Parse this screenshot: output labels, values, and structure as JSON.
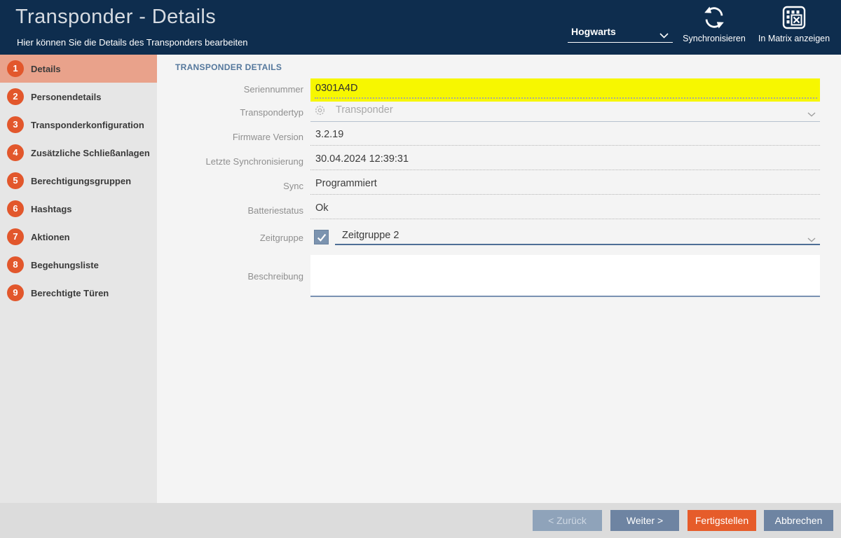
{
  "header": {
    "title": "Transponder - Details",
    "subtitle": "Hier können Sie die Details des Transponders bearbeiten",
    "project_selector": {
      "value": "Hogwarts"
    },
    "actions": [
      {
        "label": "Synchronisieren",
        "icon": "sync-icon"
      },
      {
        "label": "In Matrix anzeigen",
        "icon": "matrix-icon"
      }
    ]
  },
  "sidebar": {
    "items": [
      {
        "number": "1",
        "label": "Details",
        "active": true
      },
      {
        "number": "2",
        "label": "Personendetails",
        "active": false
      },
      {
        "number": "3",
        "label": "Transponderkonfiguration",
        "active": false
      },
      {
        "number": "4",
        "label": "Zusätzliche Schließanlagen",
        "active": false
      },
      {
        "number": "5",
        "label": "Berechtigungsgruppen",
        "active": false
      },
      {
        "number": "6",
        "label": "Hashtags",
        "active": false
      },
      {
        "number": "7",
        "label": "Aktionen",
        "active": false
      },
      {
        "number": "8",
        "label": "Begehungsliste",
        "active": false
      },
      {
        "number": "9",
        "label": "Berechtigte Türen",
        "active": false
      }
    ]
  },
  "main": {
    "section_title": "TRANSPONDER DETAILS",
    "fields": {
      "seriennummer": {
        "label": "Seriennummer",
        "value": "0301A4D",
        "highlight": "#f7f700"
      },
      "transpondertyp": {
        "label": "Transpondertyp",
        "value": "Transponder",
        "disabled": true
      },
      "firmware": {
        "label": "Firmware Version",
        "value": "3.2.19"
      },
      "letzte_sync": {
        "label": "Letzte Synchronisierung",
        "value": "30.04.2024 12:39:31"
      },
      "sync": {
        "label": "Sync",
        "value": "Programmiert"
      },
      "batteriestatus": {
        "label": "Batteriestatus",
        "value": "Ok"
      },
      "zeitgruppe": {
        "label": "Zeitgruppe",
        "checked": true,
        "value": "Zeitgruppe 2"
      },
      "beschreibung": {
        "label": "Beschreibung",
        "value": ""
      }
    }
  },
  "footer": {
    "buttons": [
      {
        "label": "< Zurück",
        "style": "disabled"
      },
      {
        "label": "Weiter >",
        "style": "normal"
      },
      {
        "label": "Fertigstellen",
        "style": "primary"
      },
      {
        "label": "Abbrechen",
        "style": "normal"
      }
    ]
  },
  "colors": {
    "header_bg": "#0e2d4e",
    "accent_orange": "#e2572c",
    "active_nav_bg": "#e9a28b",
    "highlight_yellow": "#f7f700",
    "button_blue": "#6e84a2",
    "button_orange": "#e65c2a"
  }
}
